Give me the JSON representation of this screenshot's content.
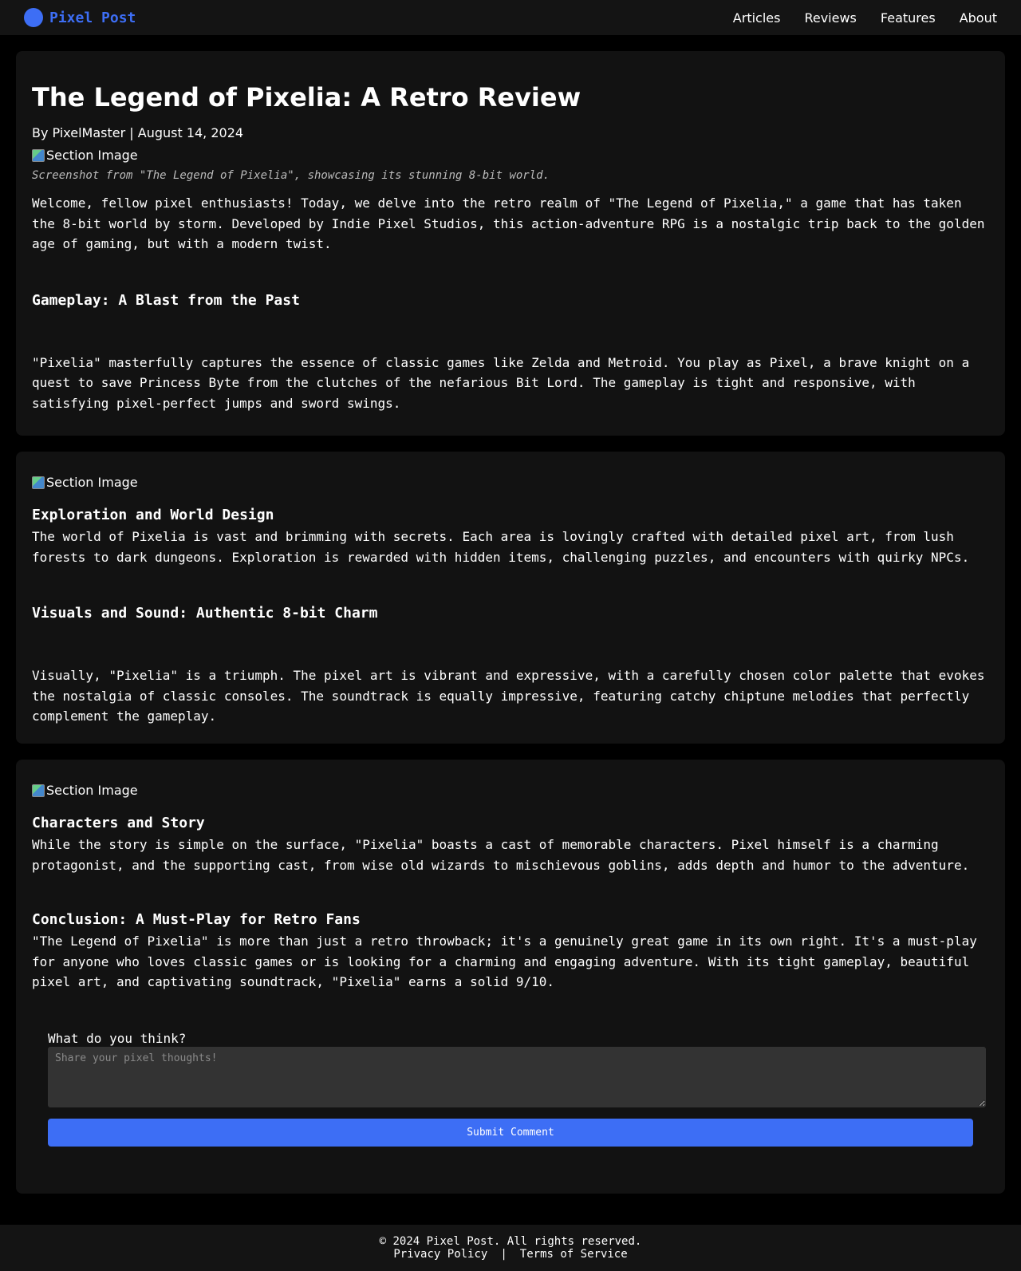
{
  "header": {
    "brand": "Pixel Post",
    "nav": [
      "Articles",
      "Reviews",
      "Features",
      "About"
    ]
  },
  "article": {
    "title": "The Legend of Pixelia: A Retro Review",
    "meta": "By PixelMaster | August 14, 2024",
    "image_alt": "Section Image",
    "caption": "Screenshot from \"The Legend of Pixelia\", showcasing its stunning 8-bit world.",
    "intro": "Welcome, fellow pixel enthusiasts! Today, we delve into the retro realm of \"The Legend of Pixelia,\" a game that has taken the 8-bit world by storm. Developed by Indie Pixel Studios, this action-adventure RPG is a nostalgic trip back to the golden age of gaming, but with a modern twist.",
    "gameplay_heading": "Gameplay: A Blast from the Past",
    "gameplay_text": "\"Pixelia\" masterfully captures the essence of classic games like Zelda and Metroid. You play as Pixel, a brave knight on a quest to save Princess Byte from the clutches of the nefarious Bit Lord. The gameplay is tight and responsive, with satisfying pixel-perfect jumps and sword swings."
  },
  "section2": {
    "image_alt": "Section Image",
    "exploration_heading": "Exploration and World Design",
    "exploration_text": "The world of Pixelia is vast and brimming with secrets. Each area is lovingly crafted with detailed pixel art, from lush forests to dark dungeons. Exploration is rewarded with hidden items, challenging puzzles, and encounters with quirky NPCs.",
    "visuals_heading": "Visuals and Sound: Authentic 8-bit Charm",
    "visuals_text": "Visually, \"Pixelia\" is a triumph. The pixel art is vibrant and expressive, with a carefully chosen color palette that evokes the nostalgia of classic consoles. The soundtrack is equally impressive, featuring catchy chiptune melodies that perfectly complement the gameplay."
  },
  "section3": {
    "image_alt": "Section Image",
    "characters_heading": "Characters and Story",
    "characters_text": "While the story is simple on the surface, \"Pixelia\" boasts a cast of memorable characters. Pixel himself is a charming protagonist, and the supporting cast, from wise old wizards to mischievous goblins, adds depth and humor to the adventure.",
    "conclusion_heading": "Conclusion: A Must-Play for Retro Fans",
    "conclusion_text": "\"The Legend of Pixelia\" is more than just a retro throwback; it's a genuinely great game in its own right. It's a must-play for anyone who loves classic games or is looking for a charming and engaging adventure. With its tight gameplay, beautiful pixel art, and captivating soundtrack, \"Pixelia\" earns a solid 9/10."
  },
  "comments": {
    "label": "What do you think?",
    "placeholder": "Share your pixel thoughts!",
    "value": "",
    "submit_label": "Submit Comment"
  },
  "footer": {
    "copyright": "© 2024 Pixel Post. All rights reserved.",
    "privacy": "Privacy Policy",
    "separator": "|",
    "terms": "Terms of Service"
  },
  "colors": {
    "accent": "#3d6ef5",
    "background": "#000000",
    "card": "#121212",
    "header": "#141414"
  }
}
